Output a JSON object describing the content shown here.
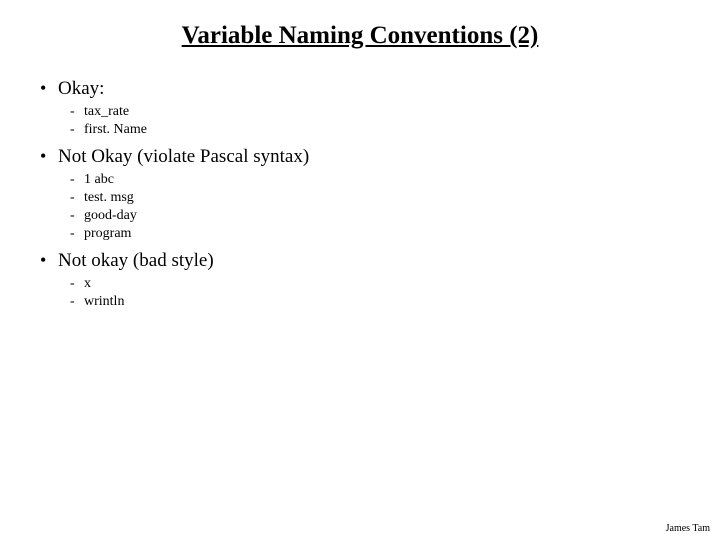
{
  "title": "Variable Naming Conventions (2)",
  "sections": [
    {
      "label": "Okay:",
      "items": [
        "tax_rate",
        "first. Name"
      ]
    },
    {
      "label": "Not Okay (violate Pascal syntax)",
      "items": [
        "1 abc",
        "test. msg",
        "good-day",
        "program"
      ]
    },
    {
      "label": "Not okay (bad style)",
      "items": [
        "x",
        "wrintln"
      ]
    }
  ],
  "footer": "James Tam"
}
